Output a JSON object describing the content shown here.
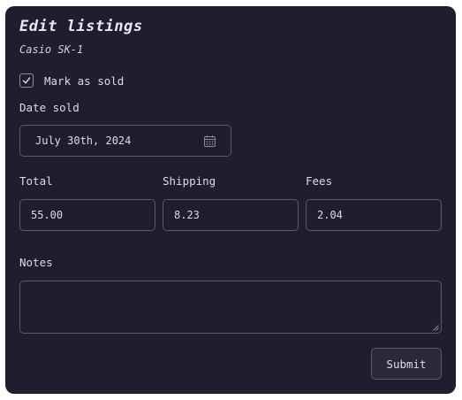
{
  "form": {
    "title": "Edit listings",
    "subtitle": "Casio SK-1",
    "mark_sold": {
      "label": "Mark as sold",
      "checked": true
    },
    "date_sold": {
      "label": "Date sold",
      "value": "July 30th, 2024",
      "icon": "calendar-icon"
    },
    "total": {
      "label": "Total",
      "value": "55.00"
    },
    "shipping": {
      "label": "Shipping",
      "value": "8.23"
    },
    "fees": {
      "label": "Fees",
      "value": "2.04"
    },
    "notes": {
      "label": "Notes",
      "value": ""
    },
    "submit_label": "Submit"
  },
  "colors": {
    "background": "#1f1e2e",
    "border": "#5a5a6a",
    "text": "#dcdce4"
  }
}
